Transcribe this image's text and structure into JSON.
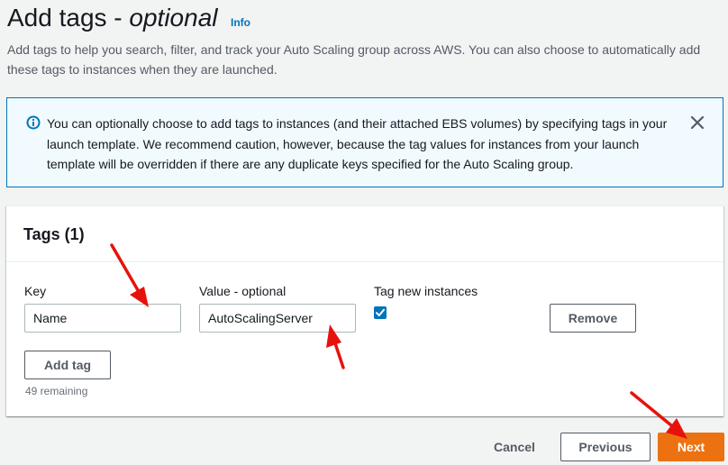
{
  "header": {
    "title_main": "Add tags - ",
    "title_optional": "optional",
    "info_link": "Info",
    "description": "Add tags to help you search, filter, and track your Auto Scaling group across AWS. You can also choose to automatically add these tags to instances when they are launched."
  },
  "alert": {
    "icon": "info-icon",
    "message": "You can optionally choose to add tags to instances (and their attached EBS volumes) by specifying tags in your launch template. We recommend caution, however, because the tag values for instances from your launch template will be overridden if there are any duplicate keys specified for the Auto Scaling group.",
    "close_icon": "close-icon"
  },
  "tags_panel": {
    "title": "Tags (1)",
    "columns": {
      "key": "Key",
      "value": "Value - optional",
      "tag_new_instances": "Tag new instances"
    },
    "rows": [
      {
        "key": "Name",
        "value": "AutoScalingServer",
        "tag_new_instances": true
      }
    ],
    "remove_label": "Remove",
    "add_tag_label": "Add tag",
    "remaining_text": "49 remaining"
  },
  "footer": {
    "cancel_label": "Cancel",
    "previous_label": "Previous",
    "next_label": "Next"
  },
  "colors": {
    "accent": "#0073bb",
    "primary_button": "#ec7211",
    "annotation_arrow": "#e8120c"
  }
}
